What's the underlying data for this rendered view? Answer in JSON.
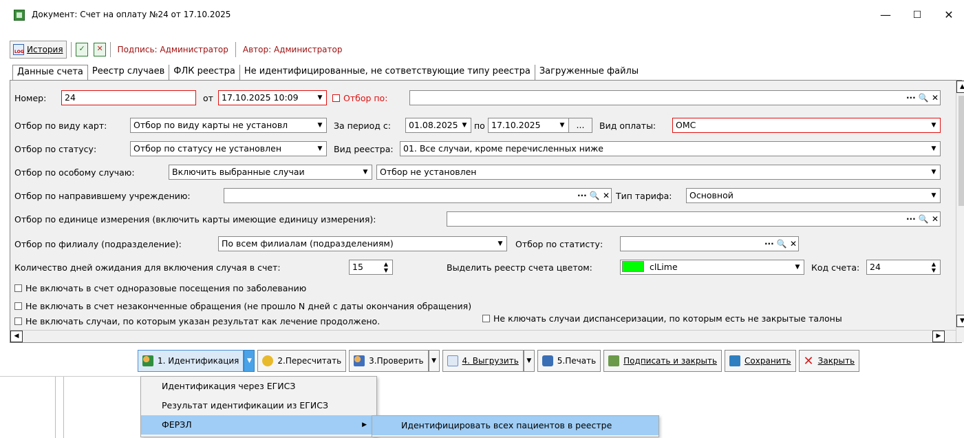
{
  "window": {
    "title": "Документ: Счет на оплату №24 от 17.10.2025",
    "minimize": "—",
    "maximize": "☐",
    "close": "✕"
  },
  "toolbar": {
    "history_label": "История",
    "signature_label": "Подпись: Администратор",
    "author_label": "Автор: Администратор"
  },
  "tabs": [
    {
      "label": "Данные счета"
    },
    {
      "label": "Реестр случаев"
    },
    {
      "label": "ФЛК реестра"
    },
    {
      "label": "Не идентифицированные, не сответствующие типу реестра"
    },
    {
      "label": "Загруженные файлы"
    }
  ],
  "form": {
    "number_label": "Номер:",
    "number_value": "24",
    "from_label": "от",
    "date_value": "17.10.2025 10:09",
    "filter_by_label": "Отбор по:",
    "filter_by_value": "",
    "card_type_label": "Отбор по виду карт:",
    "card_type_value": "Отбор по виду карты не установл",
    "period_label": "За период с:",
    "period_from": "01.08.2025",
    "period_to_label": "по",
    "period_to": "17.10.2025",
    "ellipsis": "...",
    "payment_type_label": "Вид оплаты:",
    "payment_type_value": "ОМС",
    "status_label": "Отбор по статусу:",
    "status_value": "Отбор по статусу не установлен",
    "registry_type_label": "Вид реестра:",
    "registry_type_value": "01. Все случаи, кроме перечисленных ниже",
    "special_case_label": "Отбор по особому случаю:",
    "special_case_value": "Включить выбранные случаи",
    "special_case_filter_value": "Отбор не установлен",
    "referring_label": "Отбор по направившему учреждению:",
    "referring_value": "",
    "tariff_label": "Тип тарифа:",
    "tariff_value": "Основной",
    "unit_label": "Отбор по единице измерения (включить карты имеющие единицу измерения):",
    "unit_value": "",
    "branch_label": "Отбор по филиалу (подразделение):",
    "branch_value": "По всем филиалам (подразделениям)",
    "statist_label": "Отбор по статисту:",
    "statist_value": "",
    "wait_days_label": "Количество дней ожидания для включения случая в счет:",
    "wait_days_value": "15",
    "color_label": "Выделить реестр счета цветом:",
    "color_value": "clLime",
    "color_swatch": "#00ff00",
    "invoice_code_label": "Код счета:",
    "invoice_code_value": "24",
    "actions": "··· 🔍 ✕"
  },
  "checkboxes": [
    {
      "label": "Не включать в счет одноразовые посещения по заболеванию"
    },
    {
      "label": "Не включать в счет незаконченные обращения (не прошло N дней с даты окончания обращения)"
    },
    {
      "label": "Не включать случаи, по которым указан результат как лечение продолжено."
    },
    {
      "label": "Не ключать случаи диспансеризации, по которым есть не закрытые талоны"
    }
  ],
  "buttons": {
    "identify": "1. Идентификация",
    "recalc": "2.Пересчитать",
    "check": "3.Проверить",
    "export": "4. Выгрузить",
    "print": "5.Печать",
    "sign_close": "Подписать и закрыть",
    "save": "Сохранить",
    "close": "Закрыть"
  },
  "menu": {
    "items": [
      {
        "label": "Идентификация через ЕГИСЗ"
      },
      {
        "label": "Результат идентификации из ЕГИСЗ"
      },
      {
        "label": "ФЕРЗЛ"
      }
    ],
    "submenu_item": "Идентифицировать всех пациентов в реестре"
  },
  "colors": {
    "required_border": "#e01010",
    "menu_highlight": "#9fcdf5"
  }
}
